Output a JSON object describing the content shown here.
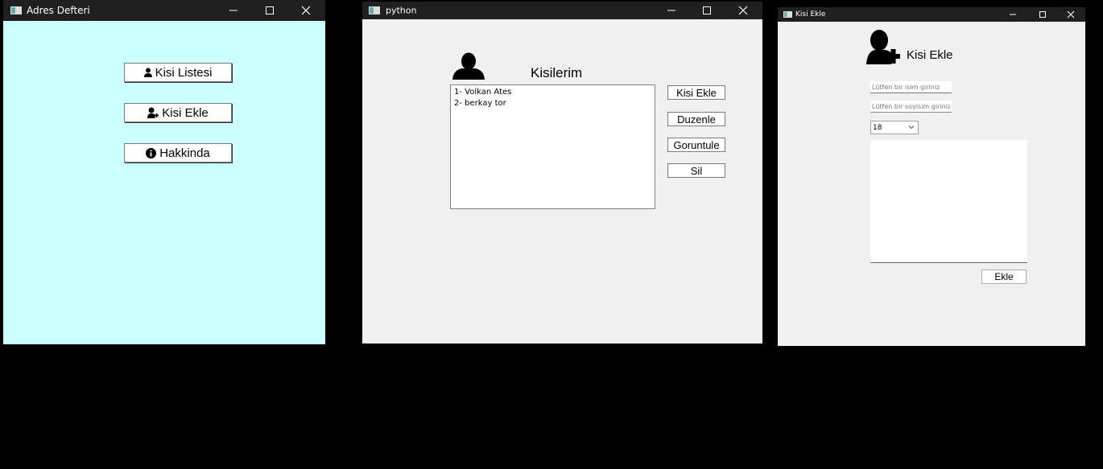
{
  "windows": {
    "adres_defteri": {
      "title": "Adres Defteri",
      "bg_color": "#ccffff",
      "buttons": {
        "kisi_listesi": "Kisi Listesi",
        "kisi_ekle": "Kisi Ekle",
        "hakkinda": "Hakkinda"
      }
    },
    "python": {
      "title": "python",
      "heading": "Kisilerim",
      "contacts": [
        "1- Volkan Ates",
        "2- berkay tor"
      ],
      "buttons": {
        "kisi_ekle": "Kisi Ekle",
        "duzenle": "Duzenle",
        "goruntule": "Goruntule",
        "sil": "Sil"
      }
    },
    "kisi_ekle": {
      "title": "Kisi Ekle",
      "heading": "Kisi Ekle",
      "name_placeholder": "Lütfen bir isim giriniz",
      "surname_placeholder": "Lütfen bir soyisim giriniz",
      "age_value": "18",
      "submit_label": "Ekle"
    }
  },
  "icons": [
    "app-icon",
    "minimize-icon",
    "maximize-icon",
    "close-icon",
    "person-icon",
    "add-person-icon",
    "info-icon",
    "chevron-down-icon"
  ]
}
